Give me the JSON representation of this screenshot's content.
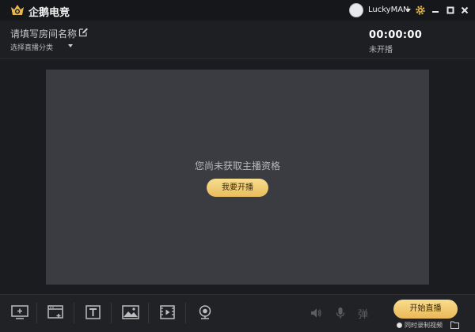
{
  "app": {
    "title": "企鹅电竞",
    "brand_color": "#e7b44c"
  },
  "user": {
    "name": "LuckyMAN"
  },
  "window_controls": [
    "minimize-icon",
    "restore-icon",
    "close-icon"
  ],
  "room": {
    "name_placeholder": "请填写房间名称",
    "category_label": "选择直播分类"
  },
  "timer": {
    "elapsed": "00:00:00",
    "status": "未开播"
  },
  "preview": {
    "notice": "您尚未获取主播资格",
    "apply_button": "我要开播"
  },
  "toolbar": {
    "tools": [
      "add-screen-icon",
      "add-window-icon",
      "add-text-icon",
      "add-image-icon",
      "add-video-icon",
      "add-camera-icon"
    ],
    "danmu_label": "弹",
    "start_live_button": "开始直播",
    "record_label": "同时录制视频"
  },
  "colors": {
    "accent_gold": "#e9bd5c",
    "background": "#1b1c20",
    "preview_bg": "#3b3c41"
  }
}
